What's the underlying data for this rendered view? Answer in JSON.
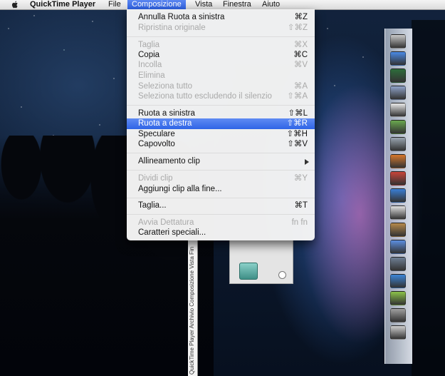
{
  "menubar": {
    "items": [
      {
        "label": "QuickTime Player"
      },
      {
        "label": "File"
      },
      {
        "label": "Composizione"
      },
      {
        "label": "Vista"
      },
      {
        "label": "Finestra"
      },
      {
        "label": "Aiuto"
      }
    ]
  },
  "menu": {
    "items": [
      {
        "label": "Annulla Ruota a sinistra",
        "shortcut": "⌘Z",
        "state": "enabled"
      },
      {
        "label": "Ripristina originale",
        "shortcut": "⇧⌘Z",
        "state": "disabled"
      },
      {
        "label": "Taglia",
        "shortcut": "⌘X",
        "state": "disabled"
      },
      {
        "label": "Copia",
        "shortcut": "⌘C",
        "state": "enabled"
      },
      {
        "label": "Incolla",
        "shortcut": "⌘V",
        "state": "disabled"
      },
      {
        "label": "Elimina",
        "shortcut": "",
        "state": "disabled"
      },
      {
        "label": "Seleziona tutto",
        "shortcut": "⌘A",
        "state": "disabled"
      },
      {
        "label": "Seleziona tutto escludendo il silenzio",
        "shortcut": "⇧⌘A",
        "state": "disabled"
      },
      {
        "label": "Ruota a sinistra",
        "shortcut": "⇧⌘L",
        "state": "enabled"
      },
      {
        "label": "Ruota a destra",
        "shortcut": "⇧⌘R",
        "state": "highlighted"
      },
      {
        "label": "Speculare",
        "shortcut": "⇧⌘H",
        "state": "enabled"
      },
      {
        "label": "Capovolto",
        "shortcut": "⇧⌘V",
        "state": "enabled"
      },
      {
        "label": "Allineamento clip",
        "shortcut": "",
        "state": "submenu"
      },
      {
        "label": "Dividi clip",
        "shortcut": "⌘Y",
        "state": "disabled"
      },
      {
        "label": "Aggiungi clip alla fine...",
        "shortcut": "",
        "state": "enabled"
      },
      {
        "label": "Taglia...",
        "shortcut": "⌘T",
        "state": "enabled"
      },
      {
        "label": "Avvia Dettatura",
        "shortcut": "fn fn",
        "state": "disabled"
      },
      {
        "label": "Caratteri speciali...",
        "shortcut": "",
        "state": "enabled"
      }
    ]
  },
  "rotated_window": {
    "menu_text": "QuickTime Player   Archivio   Composizione   Vista   Fin"
  },
  "colors": {
    "highlight": "#3a6ee8",
    "disabled_text": "#a9a9a9"
  },
  "icons": [
    "apple-icon",
    "submenu-arrow-icon",
    "dock-app-icons"
  ]
}
